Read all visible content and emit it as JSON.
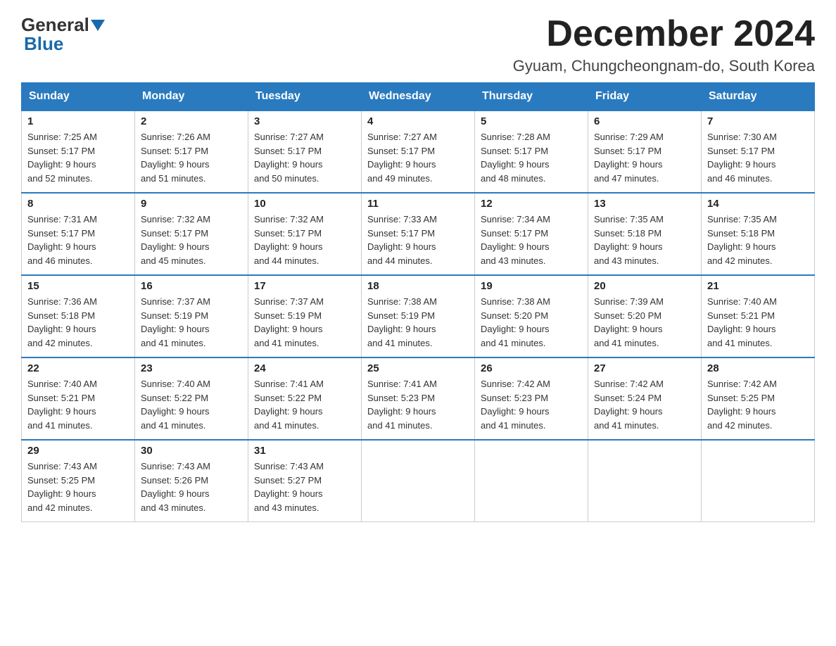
{
  "header": {
    "logo": {
      "general": "General",
      "blue": "Blue"
    },
    "title": "December 2024",
    "subtitle": "Gyuam, Chungcheongnam-do, South Korea"
  },
  "weekdays": [
    "Sunday",
    "Monday",
    "Tuesday",
    "Wednesday",
    "Thursday",
    "Friday",
    "Saturday"
  ],
  "weeks": [
    [
      {
        "day": "1",
        "sunrise": "7:25 AM",
        "sunset": "5:17 PM",
        "daylight": "9 hours and 52 minutes."
      },
      {
        "day": "2",
        "sunrise": "7:26 AM",
        "sunset": "5:17 PM",
        "daylight": "9 hours and 51 minutes."
      },
      {
        "day": "3",
        "sunrise": "7:27 AM",
        "sunset": "5:17 PM",
        "daylight": "9 hours and 50 minutes."
      },
      {
        "day": "4",
        "sunrise": "7:27 AM",
        "sunset": "5:17 PM",
        "daylight": "9 hours and 49 minutes."
      },
      {
        "day": "5",
        "sunrise": "7:28 AM",
        "sunset": "5:17 PM",
        "daylight": "9 hours and 48 minutes."
      },
      {
        "day": "6",
        "sunrise": "7:29 AM",
        "sunset": "5:17 PM",
        "daylight": "9 hours and 47 minutes."
      },
      {
        "day": "7",
        "sunrise": "7:30 AM",
        "sunset": "5:17 PM",
        "daylight": "9 hours and 46 minutes."
      }
    ],
    [
      {
        "day": "8",
        "sunrise": "7:31 AM",
        "sunset": "5:17 PM",
        "daylight": "9 hours and 46 minutes."
      },
      {
        "day": "9",
        "sunrise": "7:32 AM",
        "sunset": "5:17 PM",
        "daylight": "9 hours and 45 minutes."
      },
      {
        "day": "10",
        "sunrise": "7:32 AM",
        "sunset": "5:17 PM",
        "daylight": "9 hours and 44 minutes."
      },
      {
        "day": "11",
        "sunrise": "7:33 AM",
        "sunset": "5:17 PM",
        "daylight": "9 hours and 44 minutes."
      },
      {
        "day": "12",
        "sunrise": "7:34 AM",
        "sunset": "5:17 PM",
        "daylight": "9 hours and 43 minutes."
      },
      {
        "day": "13",
        "sunrise": "7:35 AM",
        "sunset": "5:18 PM",
        "daylight": "9 hours and 43 minutes."
      },
      {
        "day": "14",
        "sunrise": "7:35 AM",
        "sunset": "5:18 PM",
        "daylight": "9 hours and 42 minutes."
      }
    ],
    [
      {
        "day": "15",
        "sunrise": "7:36 AM",
        "sunset": "5:18 PM",
        "daylight": "9 hours and 42 minutes."
      },
      {
        "day": "16",
        "sunrise": "7:37 AM",
        "sunset": "5:19 PM",
        "daylight": "9 hours and 41 minutes."
      },
      {
        "day": "17",
        "sunrise": "7:37 AM",
        "sunset": "5:19 PM",
        "daylight": "9 hours and 41 minutes."
      },
      {
        "day": "18",
        "sunrise": "7:38 AM",
        "sunset": "5:19 PM",
        "daylight": "9 hours and 41 minutes."
      },
      {
        "day": "19",
        "sunrise": "7:38 AM",
        "sunset": "5:20 PM",
        "daylight": "9 hours and 41 minutes."
      },
      {
        "day": "20",
        "sunrise": "7:39 AM",
        "sunset": "5:20 PM",
        "daylight": "9 hours and 41 minutes."
      },
      {
        "day": "21",
        "sunrise": "7:40 AM",
        "sunset": "5:21 PM",
        "daylight": "9 hours and 41 minutes."
      }
    ],
    [
      {
        "day": "22",
        "sunrise": "7:40 AM",
        "sunset": "5:21 PM",
        "daylight": "9 hours and 41 minutes."
      },
      {
        "day": "23",
        "sunrise": "7:40 AM",
        "sunset": "5:22 PM",
        "daylight": "9 hours and 41 minutes."
      },
      {
        "day": "24",
        "sunrise": "7:41 AM",
        "sunset": "5:22 PM",
        "daylight": "9 hours and 41 minutes."
      },
      {
        "day": "25",
        "sunrise": "7:41 AM",
        "sunset": "5:23 PM",
        "daylight": "9 hours and 41 minutes."
      },
      {
        "day": "26",
        "sunrise": "7:42 AM",
        "sunset": "5:23 PM",
        "daylight": "9 hours and 41 minutes."
      },
      {
        "day": "27",
        "sunrise": "7:42 AM",
        "sunset": "5:24 PM",
        "daylight": "9 hours and 41 minutes."
      },
      {
        "day": "28",
        "sunrise": "7:42 AM",
        "sunset": "5:25 PM",
        "daylight": "9 hours and 42 minutes."
      }
    ],
    [
      {
        "day": "29",
        "sunrise": "7:43 AM",
        "sunset": "5:25 PM",
        "daylight": "9 hours and 42 minutes."
      },
      {
        "day": "30",
        "sunrise": "7:43 AM",
        "sunset": "5:26 PM",
        "daylight": "9 hours and 43 minutes."
      },
      {
        "day": "31",
        "sunrise": "7:43 AM",
        "sunset": "5:27 PM",
        "daylight": "9 hours and 43 minutes."
      },
      null,
      null,
      null,
      null
    ]
  ],
  "labels": {
    "sunrise": "Sunrise:",
    "sunset": "Sunset:",
    "daylight": "Daylight:"
  }
}
